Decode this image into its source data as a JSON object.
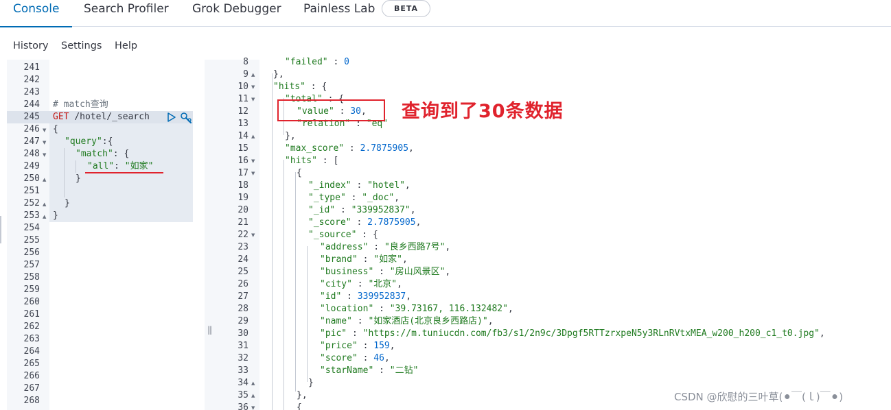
{
  "tabs": [
    {
      "label": "Console"
    },
    {
      "label": "Search Profiler"
    },
    {
      "label": "Grok Debugger"
    },
    {
      "label": "Painless Lab"
    }
  ],
  "beta_badge": "BETA",
  "submenu": {
    "history": "History",
    "settings": "Settings",
    "help": "Help"
  },
  "request": {
    "line_numbers": [
      "241",
      "242",
      "243",
      "244",
      "245",
      "246",
      "247",
      "248",
      "249",
      "250",
      "251",
      "252",
      "253",
      "254",
      "255",
      "256",
      "257",
      "258",
      "259",
      "260",
      "261",
      "262",
      "263",
      "264",
      "265",
      "266",
      "267",
      "268"
    ],
    "comment": "# match查询",
    "method": "GET",
    "path": "/hotel/_search",
    "body": {
      "open": "{",
      "query_key": "\"query\"",
      "query_open": ":{",
      "match_key": "\"match\"",
      "match_open": ": {",
      "all_key": "\"all\"",
      "all_sep": ": ",
      "all_value": "\"如家\"",
      "close1": "}",
      "close2": "}",
      "close3": "}"
    }
  },
  "response": {
    "line_numbers": [
      "8",
      "9",
      "10",
      "11",
      "12",
      "13",
      "14",
      "15",
      "16",
      "17",
      "18",
      "19",
      "20",
      "21",
      "22",
      "23",
      "24",
      "25",
      "26",
      "27",
      "28",
      "29",
      "30",
      "31",
      "32",
      "33",
      "34",
      "35",
      "36"
    ],
    "lines": [
      {
        "k": "\"failed\"",
        "s": " : ",
        "v": "0",
        "t": "num"
      },
      {
        "p": "},"
      },
      {
        "k": "\"hits\"",
        "s": " : ",
        "p2": "{"
      },
      {
        "k": "\"total\"",
        "s": " : ",
        "p2": "{"
      },
      {
        "k": "\"value\"",
        "s": " : ",
        "v": "30",
        "t": "num",
        "p2": ","
      },
      {
        "k": "\"relation\"",
        "s": " : ",
        "v": "\"eq\"",
        "t": "str"
      },
      {
        "p": "},"
      },
      {
        "k": "\"max_score\"",
        "s": " : ",
        "v": "2.7875905",
        "t": "num",
        "p2": ","
      },
      {
        "k": "\"hits\"",
        "s": " : ",
        "p2": "["
      },
      {
        "p": "{"
      },
      {
        "k": "\"_index\"",
        "s": " : ",
        "v": "\"hotel\"",
        "t": "str",
        "p2": ","
      },
      {
        "k": "\"_type\"",
        "s": " : ",
        "v": "\"_doc\"",
        "t": "str",
        "p2": ","
      },
      {
        "k": "\"_id\"",
        "s": " : ",
        "v": "\"339952837\"",
        "t": "str",
        "p2": ","
      },
      {
        "k": "\"_score\"",
        "s": " : ",
        "v": "2.7875905",
        "t": "num",
        "p2": ","
      },
      {
        "k": "\"_source\"",
        "s": " : ",
        "p2": "{"
      },
      {
        "k": "\"address\"",
        "s": " : ",
        "v": "\"良乡西路7号\"",
        "t": "str",
        "p2": ","
      },
      {
        "k": "\"brand\"",
        "s": " : ",
        "v": "\"如家\"",
        "t": "str",
        "p2": ","
      },
      {
        "k": "\"business\"",
        "s": " : ",
        "v": "\"房山风景区\"",
        "t": "str",
        "p2": ","
      },
      {
        "k": "\"city\"",
        "s": " : ",
        "v": "\"北京\"",
        "t": "str",
        "p2": ","
      },
      {
        "k": "\"id\"",
        "s": " : ",
        "v": "339952837",
        "t": "num",
        "p2": ","
      },
      {
        "k": "\"location\"",
        "s": " : ",
        "v": "\"39.73167, 116.132482\"",
        "t": "str",
        "p2": ","
      },
      {
        "k": "\"name\"",
        "s": " : ",
        "v": "\"如家酒店(北京良乡西路店)\"",
        "t": "str",
        "p2": ","
      },
      {
        "k": "\"pic\"",
        "s": " : ",
        "v": "\"https://m.tuniucdn.com/fb3/s1/2n9c/3Dpgf5RTTzrxpeN5y3RLnRVtxMEA_w200_h200_c1_t0.jpg\"",
        "t": "str",
        "p2": ","
      },
      {
        "k": "\"price\"",
        "s": " : ",
        "v": "159",
        "t": "num",
        "p2": ","
      },
      {
        "k": "\"score\"",
        "s": " : ",
        "v": "46",
        "t": "num",
        "p2": ","
      },
      {
        "k": "\"starName\"",
        "s": " : ",
        "v": "\"二钻\"",
        "t": "str"
      },
      {
        "p": "}"
      },
      {
        "p": "},"
      },
      {
        "p": "{"
      }
    ]
  },
  "annotation": "查询到了30条数据",
  "watermark": "CSDN @欣慰的三叶草(⚫￣(ｌ)￣⚫)",
  "colors": {
    "accent": "#006bb4",
    "annotation": "#e0232d",
    "string": "#1f7a1f",
    "number": "#0066cc",
    "keyword": "#c41a16"
  }
}
